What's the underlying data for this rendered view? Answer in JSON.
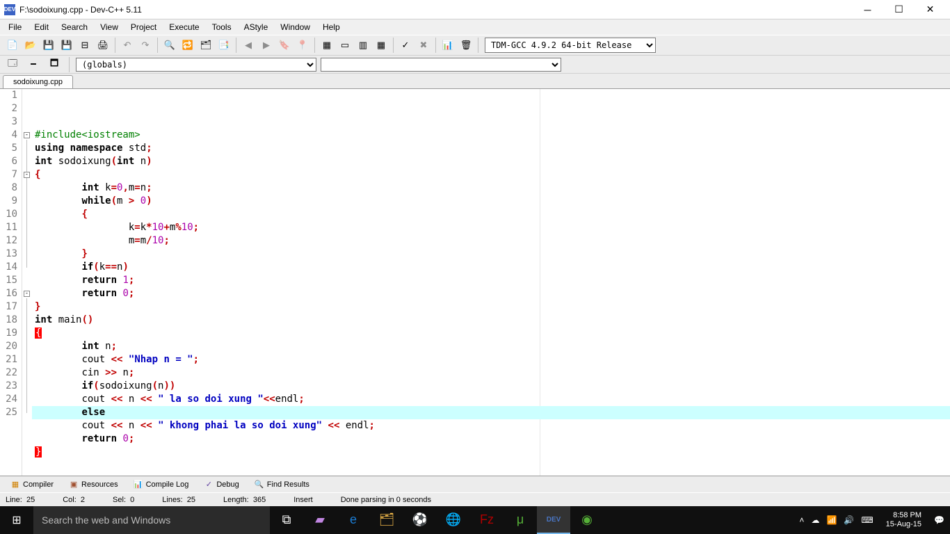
{
  "title": "F:\\sodoixung.cpp - Dev-C++ 5.11",
  "menu": [
    "File",
    "Edit",
    "Search",
    "View",
    "Project",
    "Execute",
    "Tools",
    "AStyle",
    "Window",
    "Help"
  ],
  "compiler": "TDM-GCC 4.9.2 64-bit Release",
  "globals": "(globals)",
  "tab": "sodoixung.cpp",
  "code_lines": 25,
  "code": {
    "l1": "#include<iostream>",
    "l2a": "using",
    "l2b": "namespace",
    "l2c": "std",
    "l3a": "int",
    "l3b": "sodoixung",
    "l3c": "int",
    "l3d": "n",
    "l5a": "int",
    "l5b": "k",
    "l5c": "0",
    "l5d": "m",
    "l5e": "n",
    "l6a": "while",
    "l6b": "m",
    "l6c": "0",
    "l8a": "k",
    "l8b": "k",
    "l8c": "10",
    "l8d": "m",
    "l8e": "10",
    "l9a": "m",
    "l9b": "m",
    "l9c": "10",
    "l11a": "if",
    "l11b": "k",
    "l11c": "n",
    "l12a": "return",
    "l12b": "1",
    "l13a": "return",
    "l13b": "0",
    "l15a": "int",
    "l15b": "main",
    "l17a": "int",
    "l17b": "n",
    "l18a": "cout",
    "l18b": "\"Nhap n = \"",
    "l19a": "cin",
    "l19b": "n",
    "l20a": "if",
    "l20b": "sodoixung",
    "l20c": "n",
    "l21a": "cout",
    "l21b": "n",
    "l21c": "\" la so doi xung \"",
    "l21d": "endl",
    "l22a": "else",
    "l23a": "cout",
    "l23b": "n",
    "l23c": "\" khong phai la so doi xung\"",
    "l23d": "endl",
    "l24a": "return",
    "l24b": "0"
  },
  "bottom_tabs": [
    "Compiler",
    "Resources",
    "Compile Log",
    "Debug",
    "Find Results"
  ],
  "status": {
    "line_lbl": "Line:",
    "line": "25",
    "col_lbl": "Col:",
    "col": "2",
    "sel_lbl": "Sel:",
    "sel": "0",
    "lines_lbl": "Lines:",
    "lines": "25",
    "len_lbl": "Length:",
    "len": "365",
    "mode": "Insert",
    "parse": "Done parsing in 0 seconds"
  },
  "search_placeholder": "Search the web and Windows",
  "clock": {
    "time": "8:58 PM",
    "date": "15-Aug-15"
  }
}
